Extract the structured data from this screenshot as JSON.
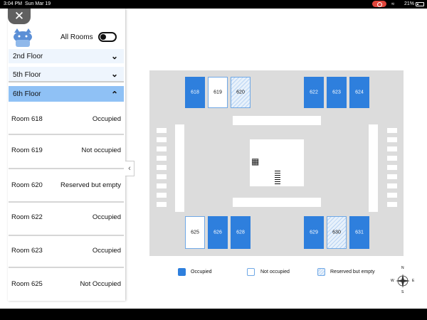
{
  "status_bar": {
    "time": "3:04 PM",
    "date": "Sun Mar 19",
    "battery": "21%"
  },
  "sidebar": {
    "all_rooms_label": "All Rooms",
    "all_rooms_toggle": "off",
    "floors": [
      {
        "label": "2nd Floor",
        "expanded": false
      },
      {
        "label": "5th Floor",
        "expanded": false
      },
      {
        "label": "6th Floor",
        "expanded": true
      }
    ],
    "rooms": [
      {
        "name": "Room 618",
        "status": "Occupied"
      },
      {
        "name": "Room 619",
        "status": "Not occupied"
      },
      {
        "name": "Room 620",
        "status": "Reserved but empty"
      },
      {
        "name": "Room 622",
        "status": "Occupied"
      },
      {
        "name": "Room 623",
        "status": "Occupied"
      },
      {
        "name": "Room 625",
        "status": "Not Occupied"
      }
    ]
  },
  "map": {
    "rooms": [
      {
        "number": "618",
        "state": "occupied"
      },
      {
        "number": "619",
        "state": "not-occupied"
      },
      {
        "number": "620",
        "state": "reserved"
      },
      {
        "number": "622",
        "state": "occupied"
      },
      {
        "number": "623",
        "state": "occupied"
      },
      {
        "number": "624",
        "state": "occupied"
      },
      {
        "number": "625",
        "state": "not-occupied"
      },
      {
        "number": "626",
        "state": "occupied"
      },
      {
        "number": "628",
        "state": "occupied"
      },
      {
        "number": "629",
        "state": "occupied"
      },
      {
        "number": "630",
        "state": "reserved"
      },
      {
        "number": "631",
        "state": "occupied"
      }
    ],
    "colors": {
      "occupied": "#2e7fdd",
      "not_occupied": "#ffffff",
      "reserved": "#b9d4f3",
      "selected_floor": "#8fc1f5"
    }
  },
  "legend": {
    "occupied": "Occupied",
    "not_occupied": "Not occupied",
    "reserved": "Reserved but empty"
  },
  "compass": {
    "n": "N",
    "s": "S",
    "e": "E",
    "w": "W"
  }
}
